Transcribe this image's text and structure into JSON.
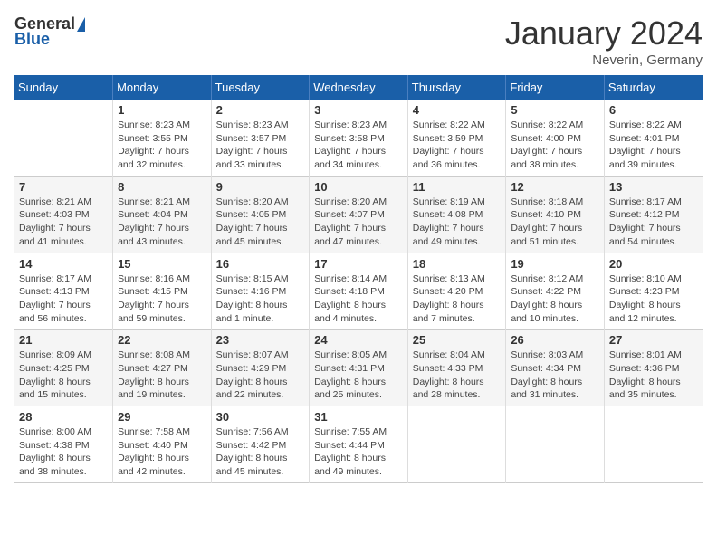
{
  "logo": {
    "general": "General",
    "blue": "Blue"
  },
  "title": {
    "month": "January 2024",
    "location": "Neverin, Germany"
  },
  "headers": [
    "Sunday",
    "Monday",
    "Tuesday",
    "Wednesday",
    "Thursday",
    "Friday",
    "Saturday"
  ],
  "weeks": [
    [
      {
        "day": "",
        "sunrise": "",
        "sunset": "",
        "daylight": ""
      },
      {
        "day": "1",
        "sunrise": "Sunrise: 8:23 AM",
        "sunset": "Sunset: 3:55 PM",
        "daylight": "Daylight: 7 hours and 32 minutes."
      },
      {
        "day": "2",
        "sunrise": "Sunrise: 8:23 AM",
        "sunset": "Sunset: 3:57 PM",
        "daylight": "Daylight: 7 hours and 33 minutes."
      },
      {
        "day": "3",
        "sunrise": "Sunrise: 8:23 AM",
        "sunset": "Sunset: 3:58 PM",
        "daylight": "Daylight: 7 hours and 34 minutes."
      },
      {
        "day": "4",
        "sunrise": "Sunrise: 8:22 AM",
        "sunset": "Sunset: 3:59 PM",
        "daylight": "Daylight: 7 hours and 36 minutes."
      },
      {
        "day": "5",
        "sunrise": "Sunrise: 8:22 AM",
        "sunset": "Sunset: 4:00 PM",
        "daylight": "Daylight: 7 hours and 38 minutes."
      },
      {
        "day": "6",
        "sunrise": "Sunrise: 8:22 AM",
        "sunset": "Sunset: 4:01 PM",
        "daylight": "Daylight: 7 hours and 39 minutes."
      }
    ],
    [
      {
        "day": "7",
        "sunrise": "Sunrise: 8:21 AM",
        "sunset": "Sunset: 4:03 PM",
        "daylight": "Daylight: 7 hours and 41 minutes."
      },
      {
        "day": "8",
        "sunrise": "Sunrise: 8:21 AM",
        "sunset": "Sunset: 4:04 PM",
        "daylight": "Daylight: 7 hours and 43 minutes."
      },
      {
        "day": "9",
        "sunrise": "Sunrise: 8:20 AM",
        "sunset": "Sunset: 4:05 PM",
        "daylight": "Daylight: 7 hours and 45 minutes."
      },
      {
        "day": "10",
        "sunrise": "Sunrise: 8:20 AM",
        "sunset": "Sunset: 4:07 PM",
        "daylight": "Daylight: 7 hours and 47 minutes."
      },
      {
        "day": "11",
        "sunrise": "Sunrise: 8:19 AM",
        "sunset": "Sunset: 4:08 PM",
        "daylight": "Daylight: 7 hours and 49 minutes."
      },
      {
        "day": "12",
        "sunrise": "Sunrise: 8:18 AM",
        "sunset": "Sunset: 4:10 PM",
        "daylight": "Daylight: 7 hours and 51 minutes."
      },
      {
        "day": "13",
        "sunrise": "Sunrise: 8:17 AM",
        "sunset": "Sunset: 4:12 PM",
        "daylight": "Daylight: 7 hours and 54 minutes."
      }
    ],
    [
      {
        "day": "14",
        "sunrise": "Sunrise: 8:17 AM",
        "sunset": "Sunset: 4:13 PM",
        "daylight": "Daylight: 7 hours and 56 minutes."
      },
      {
        "day": "15",
        "sunrise": "Sunrise: 8:16 AM",
        "sunset": "Sunset: 4:15 PM",
        "daylight": "Daylight: 7 hours and 59 minutes."
      },
      {
        "day": "16",
        "sunrise": "Sunrise: 8:15 AM",
        "sunset": "Sunset: 4:16 PM",
        "daylight": "Daylight: 8 hours and 1 minute."
      },
      {
        "day": "17",
        "sunrise": "Sunrise: 8:14 AM",
        "sunset": "Sunset: 4:18 PM",
        "daylight": "Daylight: 8 hours and 4 minutes."
      },
      {
        "day": "18",
        "sunrise": "Sunrise: 8:13 AM",
        "sunset": "Sunset: 4:20 PM",
        "daylight": "Daylight: 8 hours and 7 minutes."
      },
      {
        "day": "19",
        "sunrise": "Sunrise: 8:12 AM",
        "sunset": "Sunset: 4:22 PM",
        "daylight": "Daylight: 8 hours and 10 minutes."
      },
      {
        "day": "20",
        "sunrise": "Sunrise: 8:10 AM",
        "sunset": "Sunset: 4:23 PM",
        "daylight": "Daylight: 8 hours and 12 minutes."
      }
    ],
    [
      {
        "day": "21",
        "sunrise": "Sunrise: 8:09 AM",
        "sunset": "Sunset: 4:25 PM",
        "daylight": "Daylight: 8 hours and 15 minutes."
      },
      {
        "day": "22",
        "sunrise": "Sunrise: 8:08 AM",
        "sunset": "Sunset: 4:27 PM",
        "daylight": "Daylight: 8 hours and 19 minutes."
      },
      {
        "day": "23",
        "sunrise": "Sunrise: 8:07 AM",
        "sunset": "Sunset: 4:29 PM",
        "daylight": "Daylight: 8 hours and 22 minutes."
      },
      {
        "day": "24",
        "sunrise": "Sunrise: 8:05 AM",
        "sunset": "Sunset: 4:31 PM",
        "daylight": "Daylight: 8 hours and 25 minutes."
      },
      {
        "day": "25",
        "sunrise": "Sunrise: 8:04 AM",
        "sunset": "Sunset: 4:33 PM",
        "daylight": "Daylight: 8 hours and 28 minutes."
      },
      {
        "day": "26",
        "sunrise": "Sunrise: 8:03 AM",
        "sunset": "Sunset: 4:34 PM",
        "daylight": "Daylight: 8 hours and 31 minutes."
      },
      {
        "day": "27",
        "sunrise": "Sunrise: 8:01 AM",
        "sunset": "Sunset: 4:36 PM",
        "daylight": "Daylight: 8 hours and 35 minutes."
      }
    ],
    [
      {
        "day": "28",
        "sunrise": "Sunrise: 8:00 AM",
        "sunset": "Sunset: 4:38 PM",
        "daylight": "Daylight: 8 hours and 38 minutes."
      },
      {
        "day": "29",
        "sunrise": "Sunrise: 7:58 AM",
        "sunset": "Sunset: 4:40 PM",
        "daylight": "Daylight: 8 hours and 42 minutes."
      },
      {
        "day": "30",
        "sunrise": "Sunrise: 7:56 AM",
        "sunset": "Sunset: 4:42 PM",
        "daylight": "Daylight: 8 hours and 45 minutes."
      },
      {
        "day": "31",
        "sunrise": "Sunrise: 7:55 AM",
        "sunset": "Sunset: 4:44 PM",
        "daylight": "Daylight: 8 hours and 49 minutes."
      },
      {
        "day": "",
        "sunrise": "",
        "sunset": "",
        "daylight": ""
      },
      {
        "day": "",
        "sunrise": "",
        "sunset": "",
        "daylight": ""
      },
      {
        "day": "",
        "sunrise": "",
        "sunset": "",
        "daylight": ""
      }
    ]
  ]
}
